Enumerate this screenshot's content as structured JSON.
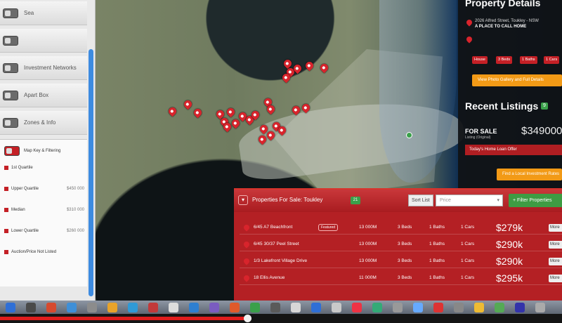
{
  "sidebar": {
    "layers": [
      {
        "label": "Sea",
        "on": false
      },
      {
        "label": "",
        "on": false
      },
      {
        "label": "Investment Networks",
        "on": false
      },
      {
        "label": "Apart Box",
        "on": false
      },
      {
        "label": "Zones & Info",
        "on": false
      },
      {
        "label": "Map Key & Filtering",
        "on": true
      }
    ],
    "filters": [
      {
        "label": "1st Quartile",
        "price": ""
      },
      {
        "label": "Upper Quartile",
        "price": "$450 000"
      },
      {
        "label": "Median",
        "price": "$310 000"
      },
      {
        "label": "Lower Quartile",
        "price": "$260 000"
      },
      {
        "label": "Auction/Price Not Listed",
        "price": ""
      }
    ]
  },
  "details": {
    "title": "Property Details",
    "address": "2026 Alfred Street, Toukley - NSW",
    "tagline": "A PLACE TO CALL HOME",
    "tags": [
      "House",
      "3 Beds",
      "1 Baths",
      "1 Cars"
    ],
    "action_button": "View Photo Gallery and Full Details",
    "recent_title": "Recent Listings",
    "recent_count": "9",
    "sale_label": "FOR SALE",
    "sale_sub": "Listing (Original)",
    "sale_price": "$349000",
    "offer_label": "Today's Home Loan Offer",
    "local_button": "Find a Local Investment Rates"
  },
  "listings": {
    "title": "Properties For Sale: Toukley",
    "count": "21",
    "sort_label": "Sort List",
    "sort_placeholder": "Price",
    "filter_button": "Filter Properties",
    "featured_label": "Featured",
    "more_label": "More",
    "rows": [
      {
        "address": "6/45 A7 Beachfront",
        "land": "13 000M",
        "beds": "3 Beds",
        "baths": "1 Baths",
        "cars": "1 Cars",
        "price": "$279k",
        "featured": true
      },
      {
        "address": "6/45 30/37 Peel Street",
        "land": "13 000M",
        "beds": "3 Beds",
        "baths": "1 Baths",
        "cars": "1 Cars",
        "price": "$290k",
        "featured": false
      },
      {
        "address": "1/3 Lakefront Village Drive",
        "land": "13 000M",
        "beds": "3 Beds",
        "baths": "1 Baths",
        "cars": "1 Cars",
        "price": "$290k",
        "featured": false
      },
      {
        "address": "18 Ellis Avenue",
        "land": "11 000M",
        "beds": "3 Beds",
        "baths": "1 Baths",
        "cars": "1 Cars",
        "price": "$295k",
        "featured": false
      }
    ]
  },
  "video": {
    "progress": 0.44
  },
  "colors": {
    "accent": "#c42026",
    "panel": "#b42024",
    "green": "#3aa04a",
    "orange": "#f29a16"
  }
}
